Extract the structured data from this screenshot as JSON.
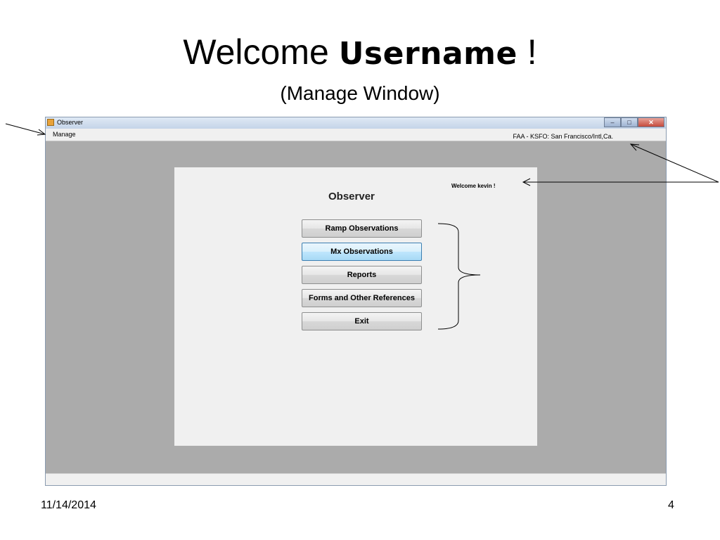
{
  "slide": {
    "title_prefix": "Welcome ",
    "title_bold": "Username",
    "title_suffix": " !",
    "subtitle": "(Manage Window)",
    "date": "11/14/2014",
    "page_number": "4"
  },
  "window": {
    "title": "Observer",
    "caption_buttons": {
      "minimize": "–",
      "maximize": "□",
      "close": "✕"
    },
    "menu": {
      "manage": "Manage"
    },
    "location_text": "FAA - KSFO: San Francisco/Intl,Ca."
  },
  "panel": {
    "welcome_text": "Welcome  kevin  !",
    "heading": "Observer",
    "buttons": [
      {
        "label": "Ramp Observations"
      },
      {
        "label": "Mx Observations"
      },
      {
        "label": "Reports"
      },
      {
        "label": "Forms and Other References"
      },
      {
        "label": "Exit"
      }
    ]
  }
}
